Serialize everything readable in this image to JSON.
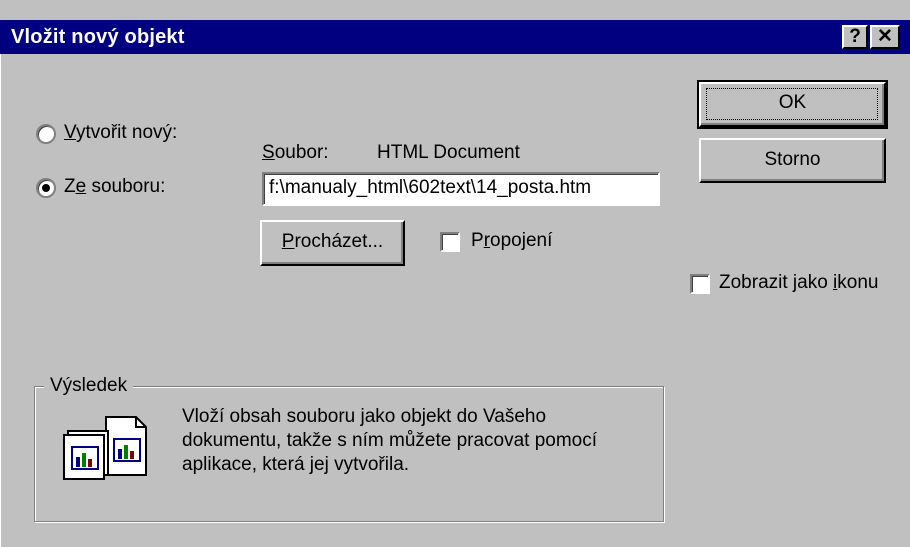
{
  "window": {
    "title": "Vložit nový objekt",
    "help_glyph": "?",
    "close_glyph": "✕"
  },
  "options": {
    "create_new": {
      "pre": "",
      "key": "V",
      "post": "ytvořit nový:",
      "selected": false
    },
    "from_file": {
      "pre": "Z",
      "key": "e",
      "post": " souboru:",
      "selected": true
    }
  },
  "file": {
    "label_key": "S",
    "label_rest": "oubor:",
    "type": "HTML Document",
    "path": "f:\\manualy_html\\602text\\14_posta.htm"
  },
  "buttons": {
    "ok": "OK",
    "cancel": "Storno",
    "browse_key": "P",
    "browse_rest": "rocházet..."
  },
  "link": {
    "pre": "P",
    "key": "r",
    "post": "opojení",
    "checked": false
  },
  "display_as_icon": {
    "pre": "Zobrazit jako ",
    "key": "i",
    "post": "konu",
    "checked": false
  },
  "result": {
    "legend": "Výsledek",
    "line1": "Vloží obsah souboru jako objekt do Vašeho",
    "line2": "dokumentu, takže s ním můžete pracovat pomocí",
    "line3": "aplikace, která jej vytvořila."
  },
  "icon": {
    "name": "document-object-icon"
  }
}
